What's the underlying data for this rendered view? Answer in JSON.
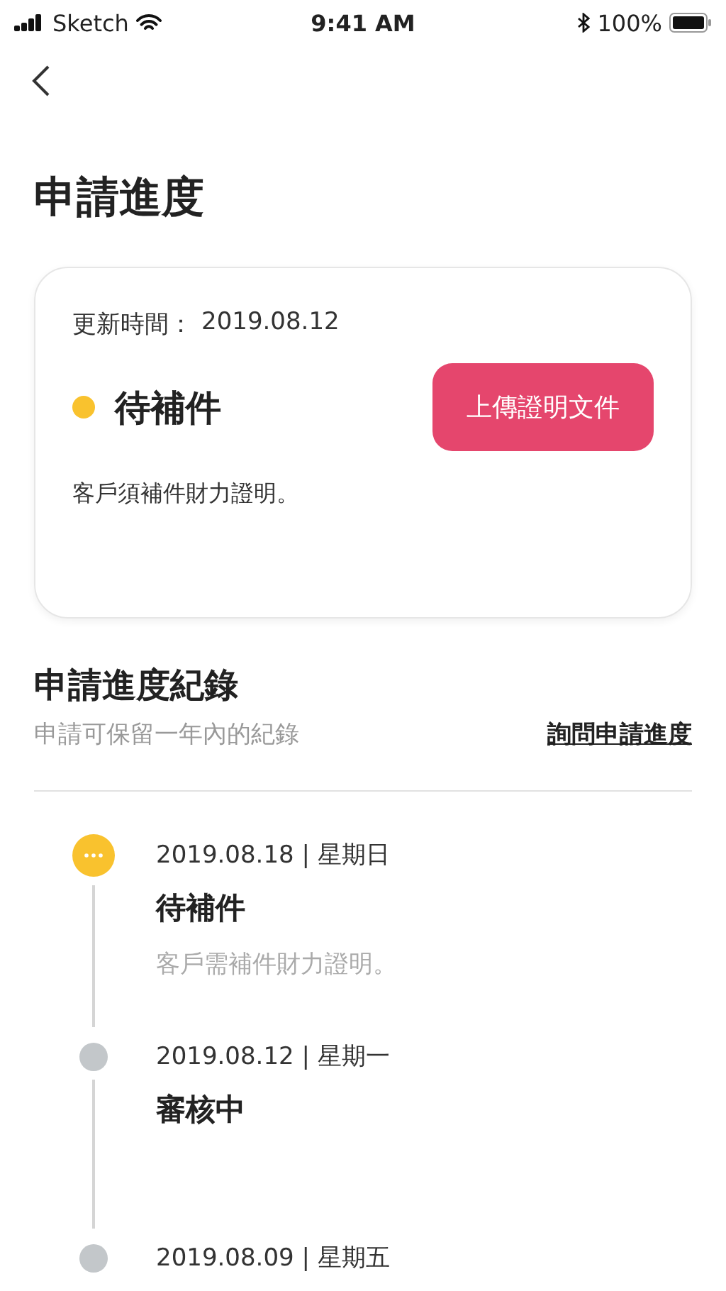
{
  "status_bar": {
    "carrier": "Sketch",
    "time": "9:41 AM",
    "battery": "100%"
  },
  "title": "申請進度",
  "card": {
    "updated_label": "更新時間：",
    "updated_date": "2019.08.12",
    "status": "待補件",
    "button": "上傳證明文件",
    "note": "客戶須補件財力證明。"
  },
  "history": {
    "title": "申請進度紀錄",
    "subtitle": "申請可保留一年內的紀錄",
    "link": "詢問申請進度"
  },
  "timeline": [
    {
      "date": "2019.08.18 | 星期日",
      "status": "待補件",
      "note": "客戶需補件財力證明。",
      "current": true,
      "color": "#f9c22e"
    },
    {
      "date": "2019.08.12 | 星期一",
      "status": "審核中",
      "current": false,
      "color": "#c3c7ca"
    },
    {
      "date": "2019.08.09 | 星期五",
      "current": false,
      "color": "#c3c7ca"
    }
  ]
}
